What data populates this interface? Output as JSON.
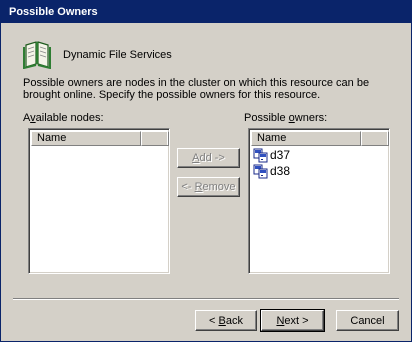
{
  "window": {
    "title": "Possible Owners"
  },
  "header": {
    "resource_name": "Dynamic File Services",
    "icon": "book-icon"
  },
  "description": "Possible owners are nodes in the cluster on which this resource can be brought online. Specify the possible owners for this resource.",
  "available": {
    "label_prefix": "A",
    "label_accel": "v",
    "label_rest": "ailable nodes:",
    "columns": [
      "Name",
      ""
    ],
    "items": []
  },
  "owners": {
    "label_prefix": "Possible ",
    "label_accel": "o",
    "label_rest": "wners:",
    "columns": [
      "Name",
      ""
    ],
    "items": [
      {
        "name": "d37",
        "icon": "cluster-node-icon"
      },
      {
        "name": "d38",
        "icon": "cluster-node-icon"
      }
    ]
  },
  "buttons": {
    "add": {
      "accel": "A",
      "rest": "dd ->"
    },
    "remove": {
      "prefix": "<- ",
      "accel": "R",
      "rest": "emove"
    },
    "back": {
      "prefix": "< ",
      "accel": "B",
      "rest": "ack"
    },
    "next": {
      "accel": "N",
      "rest": "ext >"
    },
    "cancel": {
      "label": "Cancel"
    }
  }
}
